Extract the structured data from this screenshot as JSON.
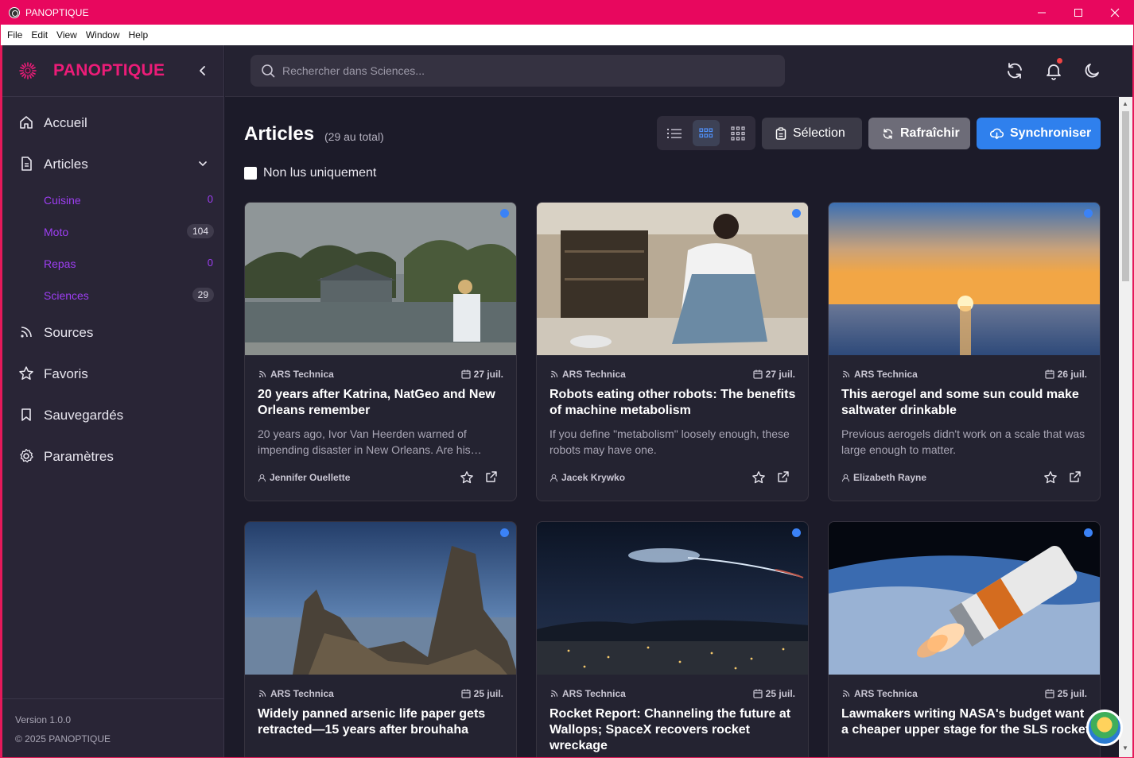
{
  "window": {
    "title": "PANOPTIQUE",
    "controls": [
      "minimize",
      "maximize",
      "close"
    ]
  },
  "menu": [
    "File",
    "Edit",
    "View",
    "Window",
    "Help"
  ],
  "brand": {
    "name": "PANOPTIQUE"
  },
  "sidebar": {
    "nav": [
      {
        "label": "Accueil",
        "icon": "home-icon"
      },
      {
        "label": "Articles",
        "icon": "document-icon"
      },
      {
        "label": "Sources",
        "icon": "rss-icon"
      },
      {
        "label": "Favoris",
        "icon": "star-icon"
      },
      {
        "label": "Sauvegardés",
        "icon": "bookmark-icon"
      },
      {
        "label": "Paramètres",
        "icon": "gear-icon"
      }
    ],
    "categories": [
      {
        "label": "Cuisine",
        "count": "0"
      },
      {
        "label": "Moto",
        "count": "104"
      },
      {
        "label": "Repas",
        "count": "0"
      },
      {
        "label": "Sciences",
        "count": "29"
      }
    ],
    "footer": {
      "version": "Version 1.0.0",
      "copyright": "© 2025 PANOPTIQUE"
    }
  },
  "search": {
    "placeholder": "Rechercher dans Sciences..."
  },
  "main": {
    "title": "Articles",
    "count": "(29 au total)",
    "buttons": {
      "selection": "Sélection",
      "refresh": "Rafraîchir",
      "sync": "Synchroniser"
    },
    "unread_only": "Non lus uniquement"
  },
  "colors": {
    "accent": "#ec1c78",
    "primary": "#2f80ed",
    "unread_dot": "#3b82f6",
    "category": "#9d3ef2"
  },
  "articles": [
    {
      "source": "ARS Technica",
      "date": "27 juil.",
      "title": "20 years after Katrina, NatGeo and New Orleans remember",
      "desc": "20 years ago, Ivor Van Heerden warned of impending disaster in New Orleans. Are his…",
      "author": "Jennifer Ouellette"
    },
    {
      "source": "ARS Technica",
      "date": "27 juil.",
      "title": "Robots eating other robots: The benefits of machine metabolism",
      "desc": "If you define \"metabolism\" loosely enough, these robots may have one.",
      "author": "Jacek Krywko"
    },
    {
      "source": "ARS Technica",
      "date": "26 juil.",
      "title": "This aerogel and some sun could make saltwater drinkable",
      "desc": "Previous aerogels didn't work on a scale that was large enough to matter.",
      "author": "Elizabeth Rayne"
    },
    {
      "source": "ARS Technica",
      "date": "25 juil.",
      "title": "Widely panned arsenic life paper gets retracted—15 years after brouhaha",
      "desc": "",
      "author": ""
    },
    {
      "source": "ARS Technica",
      "date": "25 juil.",
      "title": "Rocket Report: Channeling the future at Wallops; SpaceX recovers rocket wreckage",
      "desc": "",
      "author": ""
    },
    {
      "source": "ARS Technica",
      "date": "25 juil.",
      "title": "Lawmakers writing NASA's budget want a cheaper upper stage for the SLS rocket",
      "desc": "",
      "author": ""
    }
  ]
}
